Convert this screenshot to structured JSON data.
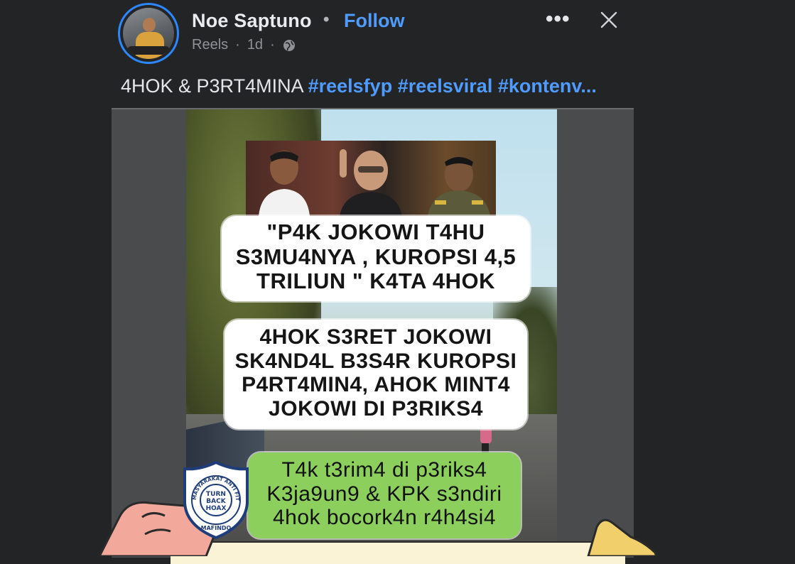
{
  "post": {
    "author": "Noe Saptuno",
    "separator": "•",
    "follow_label": "Follow",
    "meta_source": "Reels",
    "meta_dot": "·",
    "meta_time": "1d",
    "meta_dot2": "·",
    "privacy_icon": "globe-icon",
    "more_label": "•••",
    "close_icon": "close-icon"
  },
  "caption": {
    "text": "4HOK & P3RT4MINA",
    "hashtags": [
      "#reelsfyp",
      "#reelsviral",
      "#kontenv..."
    ]
  },
  "video": {
    "bubble1": [
      "\"P4K JOKOWI T4HU",
      "S3MU4NYA , KUROPSI 4,5",
      "TRILIUN \" K4TA 4HOK"
    ],
    "bubble2": [
      "4HOK S3RET JOKOWI",
      "SK4ND4L B3S4R KUROPSI",
      "P4RT4MIN4, AHOK MINT4",
      "JOKOWI DI P3RIKS4"
    ],
    "bubble3": [
      "T4k t3rim4 di p3riks4",
      "K3ja9un9 & KPK s3ndiri",
      "4hok bocork4n r4h4si4"
    ]
  },
  "watermark": {
    "ring_text": "MASYARAKAT ANTI FITNAH INDONESIA",
    "center_line1": "TURN",
    "center_line2": "BACK",
    "center_line3": "HOAX",
    "bottom_text": "MAFINDO"
  },
  "colors": {
    "background": "#232425",
    "accent": "#4f9bff",
    "green_bubble": "#8ccf5d"
  }
}
